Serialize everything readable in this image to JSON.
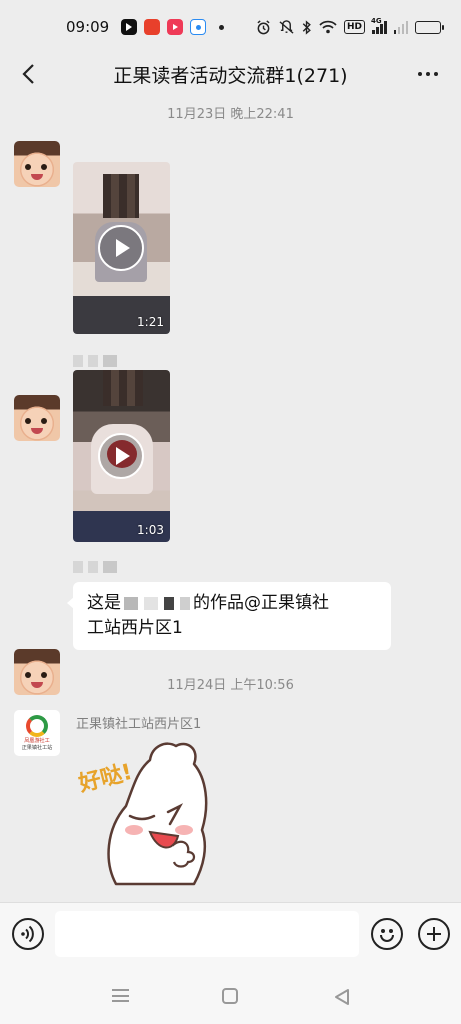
{
  "status_bar": {
    "time": "09:09",
    "icons": [
      "tiktok-icon",
      "app-badge-icon",
      "red-app-icon",
      "blue-app-icon",
      "dot-icon",
      "alarm-icon",
      "mute-icon",
      "bluetooth-icon",
      "wifi-icon",
      "hd-icon",
      "signal-icon",
      "signal-2-icon",
      "battery-icon"
    ],
    "hd_label": "HD",
    "net_label": "4G",
    "battery_level": 0.75
  },
  "header": {
    "title": "正果读者活动交流群1(271)",
    "back_icon": "chevron-left-icon",
    "more_icon": "more-horizontal-icon"
  },
  "chat": {
    "timestamp_1": "11月23日 晚上22:41",
    "video_1": {
      "duration": "1:21"
    },
    "video_2": {
      "duration": "1:03"
    },
    "text_message": {
      "prefix": "这是",
      "middle": "的作品@正果镇社",
      "line2": "工站西片区1"
    },
    "timestamp_2": "11月24日 上午10:56",
    "sender_name": "正果镇社工站西片区1",
    "logo_text_1": "凤凰游社工",
    "logo_text_2": "正果镇社工站",
    "sticker_text": "好哒!"
  },
  "input_bar": {
    "voice_icon": "voice-icon",
    "emoji_icon": "emoji-icon",
    "plus_icon": "plus-circle-icon",
    "placeholder": ""
  },
  "colors": {
    "chat_bg": "#ededed",
    "bubble": "#ffffff",
    "accent_battery": "#f2b705"
  }
}
